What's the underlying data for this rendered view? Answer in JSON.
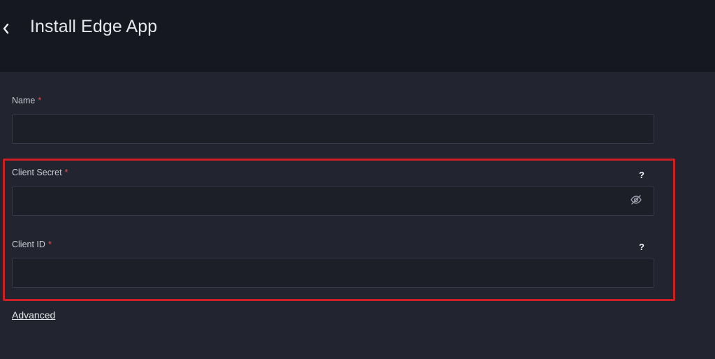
{
  "header": {
    "title": "Install Edge App",
    "back_icon": "chevron-left-icon"
  },
  "form": {
    "required_marker": "*",
    "name": {
      "label": "Name",
      "value": "",
      "placeholder": ""
    },
    "client_secret": {
      "label": "Client Secret",
      "value": "",
      "placeholder": "",
      "help": "?",
      "visibility_icon": "eye-off-icon"
    },
    "client_id": {
      "label": "Client ID",
      "value": "",
      "placeholder": "",
      "help": "?"
    },
    "advanced_label": "Advanced"
  },
  "colors": {
    "header_bg": "#161821",
    "page_bg": "#22242f",
    "input_bg": "#1c1e28",
    "required": "#e05252",
    "highlight": "#cc1f24"
  }
}
